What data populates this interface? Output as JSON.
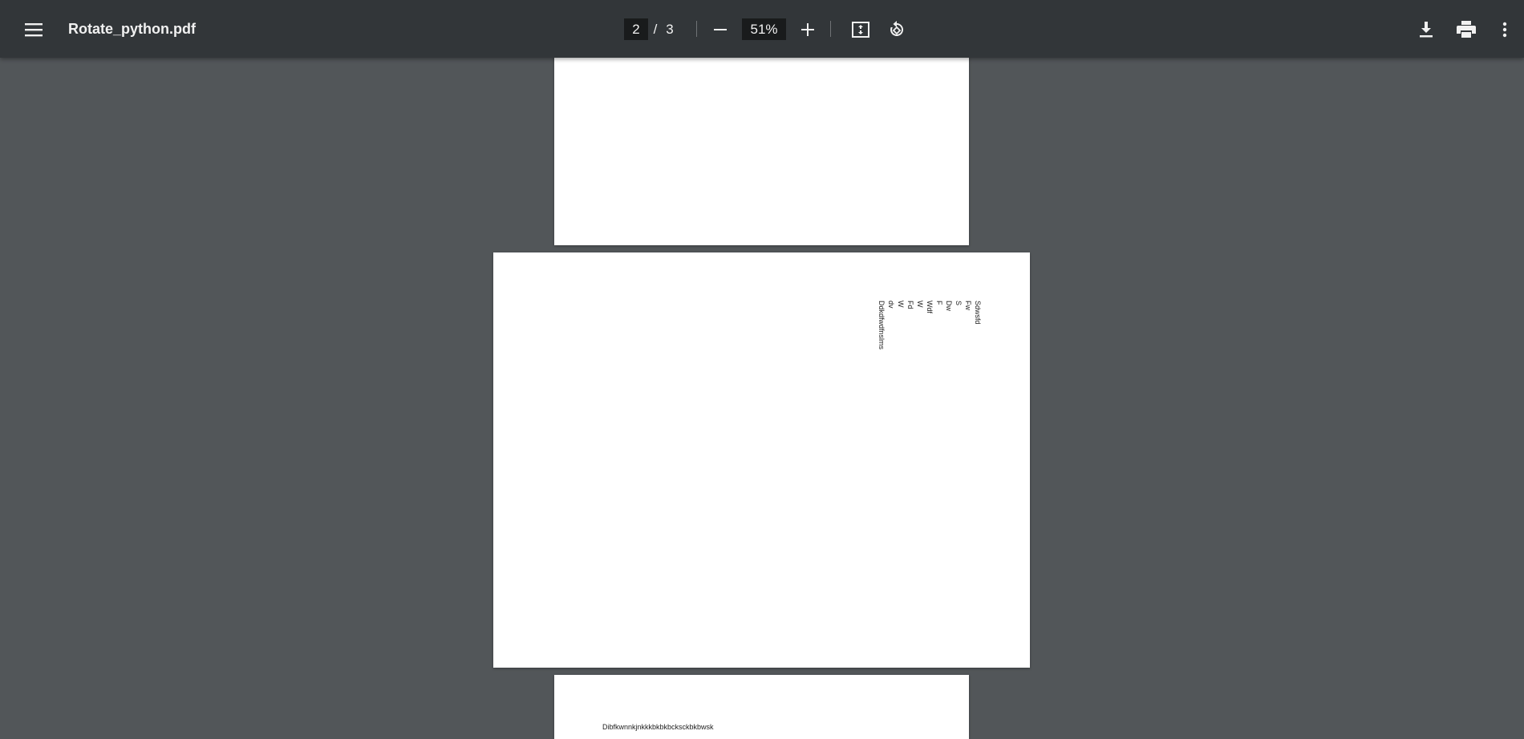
{
  "toolbar": {
    "menu_icon": "hamburger-menu-icon",
    "title": "Rotate_python.pdf",
    "page_current": "2",
    "page_separator": "/",
    "page_total": "3",
    "zoom_out_icon": "minus-icon",
    "zoom_value": "51%",
    "zoom_in_icon": "plus-icon",
    "fit_icon": "fit-to-page-icon",
    "rotate_icon": "rotate-counterclockwise-icon",
    "download_icon": "download-icon",
    "print_icon": "print-icon",
    "more_icon": "more-vertical-icon"
  },
  "document": {
    "page2_lines": [
      "Sdwsfd",
      "Fw",
      "S",
      "Dw",
      "F",
      "Wdf",
      "W",
      "Fd",
      "W",
      "dv",
      "Ddkdfwdfnslms"
    ],
    "page3_line": "Dibfkwnnkjnkkkbkbkbcksckbkbwsk"
  },
  "colors": {
    "toolbar_bg": "#323639",
    "viewer_bg": "#525659",
    "page_bg": "#ffffff",
    "input_bg": "#191b1c"
  }
}
